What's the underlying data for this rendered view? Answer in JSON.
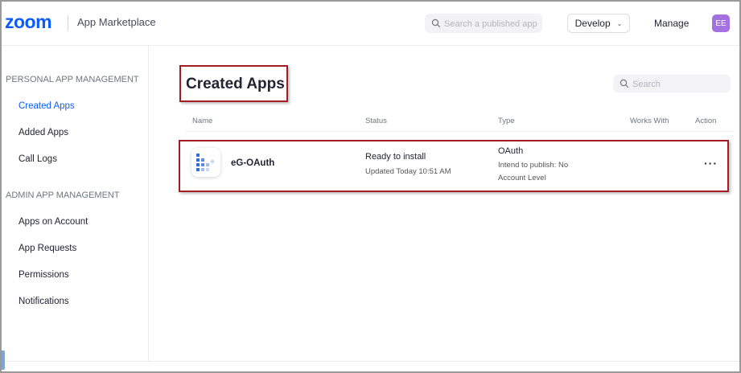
{
  "header": {
    "logo": "zoom",
    "app_title": "App Marketplace",
    "search_placeholder": "Search a published app",
    "develop_label": "Develop",
    "manage_label": "Manage",
    "avatar_initials": "EE",
    "avatar_color": "#a472e0",
    "brand_color": "#0b5cff"
  },
  "sidebar": {
    "personal_title": "PERSONAL APP MANAGEMENT",
    "personal_items": [
      "Created Apps",
      "Added Apps",
      "Call Logs"
    ],
    "admin_title": "ADMIN APP MANAGEMENT",
    "admin_items": [
      "Apps on Account",
      "App Requests",
      "Permissions",
      "Notifications"
    ],
    "active_item": "Created Apps"
  },
  "main": {
    "title": "Created Apps",
    "search_placeholder": "Search",
    "columns": [
      "Name",
      "Status",
      "Type",
      "Works With",
      "Action"
    ],
    "rows": [
      {
        "name": "eG-OAuth",
        "status": "Ready to install",
        "updated": "Updated Today 10:51 AM",
        "type": "OAuth",
        "publish": "Intend to publish: No",
        "level": "Account Level",
        "action": "···"
      }
    ]
  }
}
